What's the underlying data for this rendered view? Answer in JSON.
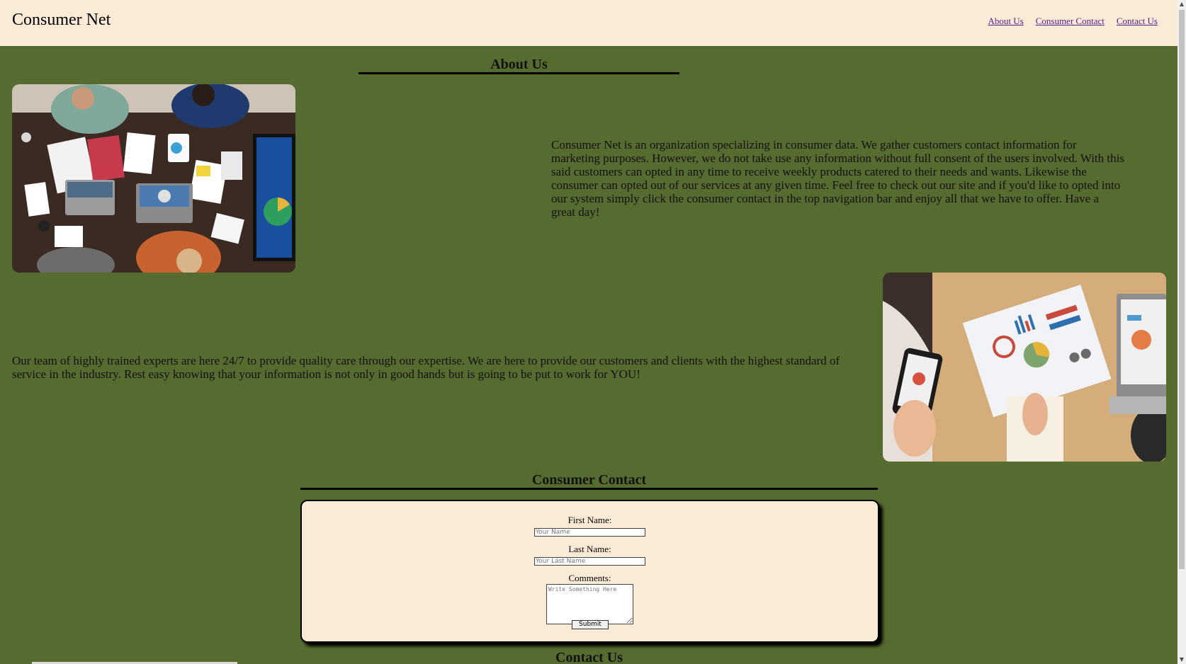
{
  "header": {
    "brand": "Consumer Net",
    "nav": [
      "About Us",
      "Consumer Contact",
      "Contact Us"
    ]
  },
  "about": {
    "title": "About Us",
    "paragraph1": "Consumer Net is an organization specializing in consumer data. We gather customers contact information for marketing purposes. However, we do not take use any information without full consent of the users involved. With this said customers can opted in any time to receive weekly products catered to their needs and wants. Likewise the consumer can opted out of our services at any given time. Feel free to check out our site and if you'd like to opted into our system simply click the consumer contact in the top navigation bar and enjoy all that we have to offer. Have a great day!",
    "paragraph2": "Our team of highly trained experts are here 24/7 to provide quality care through our expertise. We are here to provide our customers and clients with the highest standard of service in the industry. Rest easy knowing that your information is not only in good hands but is going to be put to work for YOU!",
    "image1_icon": "team-meeting-photo",
    "image2_icon": "analytics-charts-photo"
  },
  "consumer_contact": {
    "title": "Consumer Contact",
    "first_name_label": "First Name:",
    "first_name_placeholder": "Your Name",
    "last_name_label": "Last Name:",
    "last_name_placeholder": "Your Last Name",
    "comments_label": "Comments:",
    "comments_placeholder": "Write Something Here",
    "submit_label": "Submit"
  },
  "contact_us": {
    "title": "Contact Us"
  },
  "colors": {
    "background": "#556b2f",
    "header": "#faebd7",
    "link": "#551a8b"
  }
}
